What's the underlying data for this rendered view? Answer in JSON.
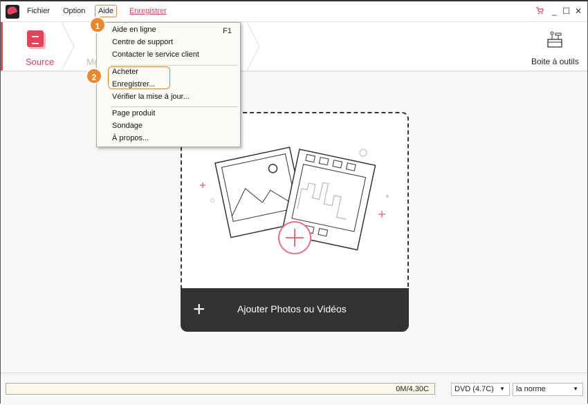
{
  "menubar": {
    "items": [
      "Fichier",
      "Option",
      "Aide",
      "Enregistrer"
    ]
  },
  "window_controls": {
    "cart": "cart-icon",
    "minimize": "_",
    "maximize": "☐",
    "close": "✕"
  },
  "tabs": {
    "source": "Source",
    "menu_partial": "Me",
    "toolbox": "Boite à outils"
  },
  "help_menu": {
    "items": [
      {
        "label": "Aide en ligne",
        "shortcut": "F1"
      },
      {
        "label": "Centre de support"
      },
      {
        "label": "Contacter le service client"
      },
      {
        "label": "Acheter"
      },
      {
        "label": "Enregistrer..."
      },
      {
        "label": "Vérifier la mise à jour..."
      },
      {
        "label": "Page produit"
      },
      {
        "label": "Sondage"
      },
      {
        "label": "À propos..."
      }
    ]
  },
  "callouts": [
    "1",
    "2"
  ],
  "drop_area": {
    "add_label": "Ajouter Photos ou Vidéos",
    "plus": "+"
  },
  "status": {
    "capacity": "0M/4.30C",
    "disc": "DVD (4.7C)",
    "quality": "la norme"
  },
  "colors": {
    "accent": "#e8425a",
    "callout": "#e8892f",
    "footer": "#333333"
  }
}
